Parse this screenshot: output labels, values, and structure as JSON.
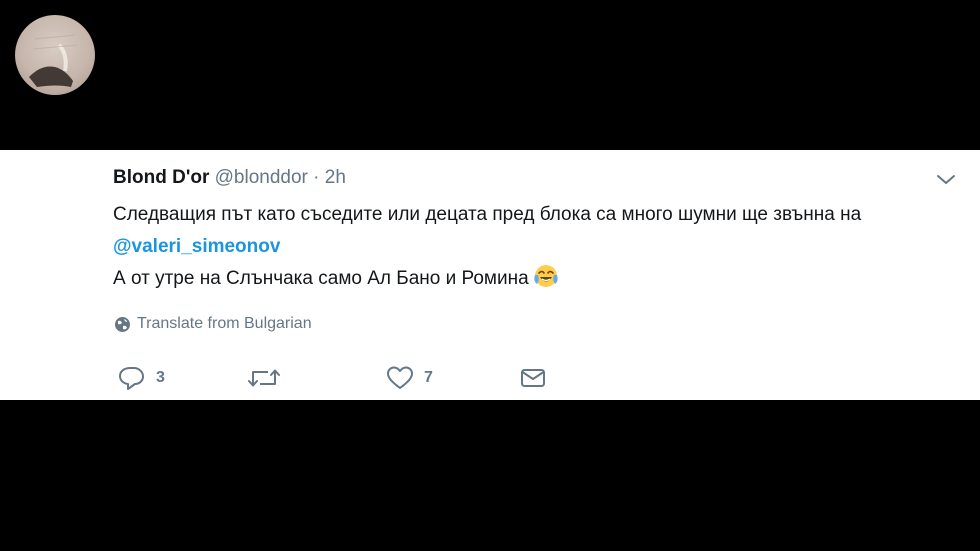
{
  "tweet": {
    "display_name": "Blond D'or",
    "handle": "@blonddor",
    "separator": "·",
    "time": "2h",
    "text_part1": "Следващия път като съседите или децата пред блока са много шумни ще звънна на ",
    "mention": "@valeri_simeonov",
    "text_line2": "А от утре на Слънчака само Ал Бано и Ромина",
    "emoji": "face-with-tears-of-joy",
    "translate_label": "Translate from Bulgarian"
  },
  "actions": {
    "reply_count": "3",
    "retweet_count": "",
    "like_count": "7"
  },
  "colors": {
    "background": "#000000",
    "card": "#ffffff",
    "text": "#14171a",
    "muted": "#657786",
    "link": "#1b95e0"
  }
}
